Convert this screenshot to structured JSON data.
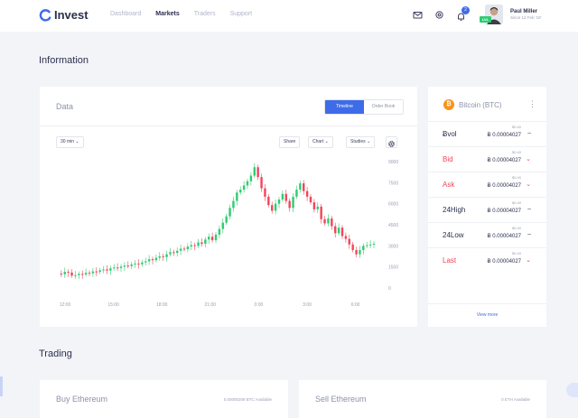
{
  "app": {
    "name": "Invest"
  },
  "nav": [
    {
      "label": "Dashboard",
      "active": false
    },
    {
      "label": "Markets",
      "active": true
    },
    {
      "label": "Traders",
      "active": false
    },
    {
      "label": "Support",
      "active": false
    }
  ],
  "user": {
    "name": "Paul Miller",
    "since": "Since 12 Feb '18'",
    "badge": "LVL",
    "notifications": "2"
  },
  "information": {
    "section_title": "Information",
    "data_card": {
      "title": "Data",
      "tabs": [
        {
          "label": "Timeline",
          "active": true
        },
        {
          "label": "Order Book",
          "active": false
        }
      ],
      "toolbar": {
        "interval": "30 min",
        "share": "Share",
        "chart": "Chart",
        "studies": "Studies"
      }
    },
    "btc_card": {
      "title": "Bitcoin (BTC)",
      "rows": [
        {
          "label": "Ƀvol",
          "small": "$0.40",
          "value": "Ƀ 0.00004027",
          "color": "dark",
          "mark": "–"
        },
        {
          "label": "Bid",
          "small": "$0.40",
          "value": "Ƀ 0.00004027",
          "color": "red",
          "mark": "⌄"
        },
        {
          "label": "Ask",
          "small": "$0.40",
          "value": "Ƀ 0.00004027",
          "color": "red",
          "mark": "⌄"
        },
        {
          "label": "24High",
          "small": "$0.40",
          "value": "Ƀ 0.00004027",
          "color": "dark",
          "mark": "–"
        },
        {
          "label": "24Low",
          "small": "$0.40",
          "value": "Ƀ 0.00004027",
          "color": "dark",
          "mark": "–"
        },
        {
          "label": "Last",
          "small": "$0.40",
          "value": "Ƀ 0.00004027",
          "color": "red",
          "mark": "⌄"
        }
      ],
      "view_more": "View more"
    }
  },
  "trading": {
    "section_title": "Trading",
    "buy": {
      "title": "Buy Ethereum",
      "available": "0.00000209 BTC Available"
    },
    "sell": {
      "title": "Sell Ethereum",
      "available": "0 ETH Available"
    }
  },
  "colors": {
    "accent": "#3e6ce8",
    "up": "#2ecc71",
    "down": "#f0465a",
    "btc": "#f7931a"
  },
  "chart_data": {
    "type": "candlestick",
    "x_ticks": [
      "12:00",
      "15:00",
      "18:00",
      "21:00",
      "0:00",
      "3:00",
      "6:00"
    ],
    "y_ticks": [
      "9000",
      "7500",
      "6000",
      "4500",
      "3000",
      "1500",
      "0"
    ],
    "ylim": [
      0,
      9000
    ],
    "close_values": [
      1020,
      980,
      1150,
      1100,
      880,
      910,
      1000,
      960,
      1080,
      1050,
      1180,
      1150,
      1260,
      1320,
      1240,
      1400,
      1460,
      1420,
      1520,
      1600,
      1560,
      1680,
      1740,
      1690,
      1820,
      1900,
      2050,
      1980,
      2150,
      2260,
      2200,
      2400,
      2550,
      2500,
      2650,
      2800,
      2760,
      2950,
      3050,
      3000,
      3250,
      3150,
      3450,
      3650,
      3400,
      3800,
      4200,
      4650,
      5100,
      5700,
      6200,
      6800,
      7000,
      7300,
      7600,
      8000,
      8600,
      7900,
      7100,
      6500,
      5900,
      5500,
      6000,
      6300,
      6700,
      6200,
      5700,
      6500,
      7000,
      7450,
      6900,
      6500,
      6100,
      5600,
      5800,
      4900,
      4600,
      4950,
      4400,
      3900,
      4300,
      3700,
      3500,
      3100,
      2700,
      2400,
      2700,
      3000,
      3050,
      3100,
      3150
    ]
  }
}
